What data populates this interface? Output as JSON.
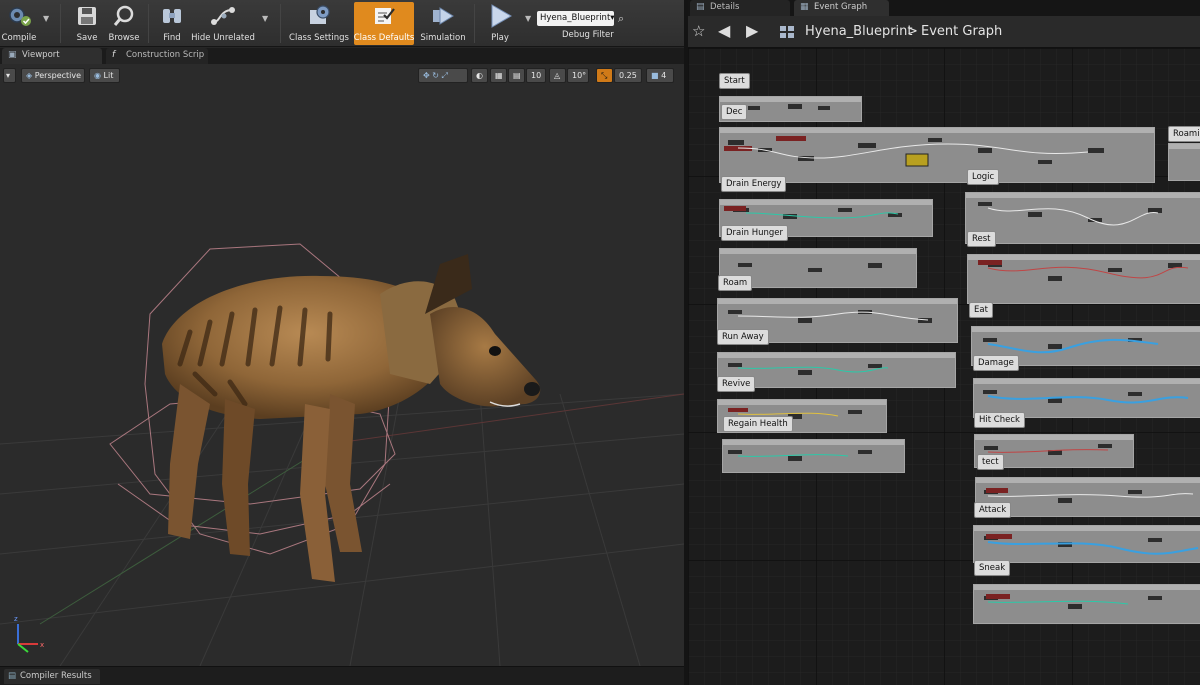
{
  "toolbar": {
    "compile": "Compile",
    "save": "Save",
    "browse": "Browse",
    "find": "Find",
    "hide_unrelated": "Hide Unrelated",
    "class_settings": "Class Settings",
    "class_defaults": "Class Defaults",
    "simulation": "Simulation",
    "play": "Play",
    "debug_object": "Hyena_Blueprint",
    "debug_filter": "Debug Filter"
  },
  "left_tabs": {
    "viewport": "Viewport",
    "construction_script": "Construction Scrip"
  },
  "viewport": {
    "view_mode": "Perspective",
    "lit_mode": "Lit",
    "grid_snap": "10",
    "rotation_snap": "10°",
    "scale_snap": "0.25",
    "camera_speed": "4"
  },
  "bottom": {
    "compiler_results": "Compiler Results"
  },
  "right_tabs": {
    "details": "Details",
    "event_graph": "Event Graph"
  },
  "breadcrumb": {
    "blueprint": "Hyena_Blueprint",
    "graph": "Event Graph",
    "separator": ">"
  },
  "graph_labels": [
    "Start",
    "Dec",
    "Roami",
    "Drain Energy",
    "Logic",
    "Drain Hunger",
    "Rest",
    "Roam",
    "Eat",
    "Run Away",
    "Damage",
    "Revive",
    "Hit Check",
    "Regain Health",
    "tect",
    "Attack",
    "Sneak"
  ],
  "colors": {
    "accent": "#e08a1e",
    "graph_box": "#8d8d8d",
    "canvas_bg": "#1c1c1c",
    "collision_wire": "#c98a93"
  }
}
